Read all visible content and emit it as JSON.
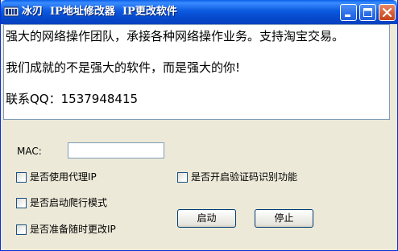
{
  "window": {
    "title": "冰刃  IP地址修改器  IP更改软件"
  },
  "info_box": {
    "lines": [
      "强大的网络操作团队，承接各种网络操作业务。支持淘宝交易。",
      "我们成就的不是强大的软件，而是强大的你!",
      "联系QQ：1537948415"
    ]
  },
  "form": {
    "mac_label": "MAC:",
    "mac_value": "",
    "checkboxes": [
      {
        "label": "是否使用代理IP",
        "checked": false
      },
      {
        "label": "是否开启验证码识别功能",
        "checked": false
      },
      {
        "label": "是否启动爬行模式",
        "checked": false
      },
      {
        "label": "是否准备随时更改IP",
        "checked": false
      }
    ],
    "start_button": "启动",
    "stop_button": "停止"
  },
  "colors": {
    "titlebar": "#0a5fe8",
    "window_bg": "#ece9d8",
    "close_button": "#d8582f"
  },
  "icons": {
    "app": "app-icon",
    "minimize": "minimize-icon",
    "maximize": "maximize-icon",
    "close": "close-icon"
  }
}
